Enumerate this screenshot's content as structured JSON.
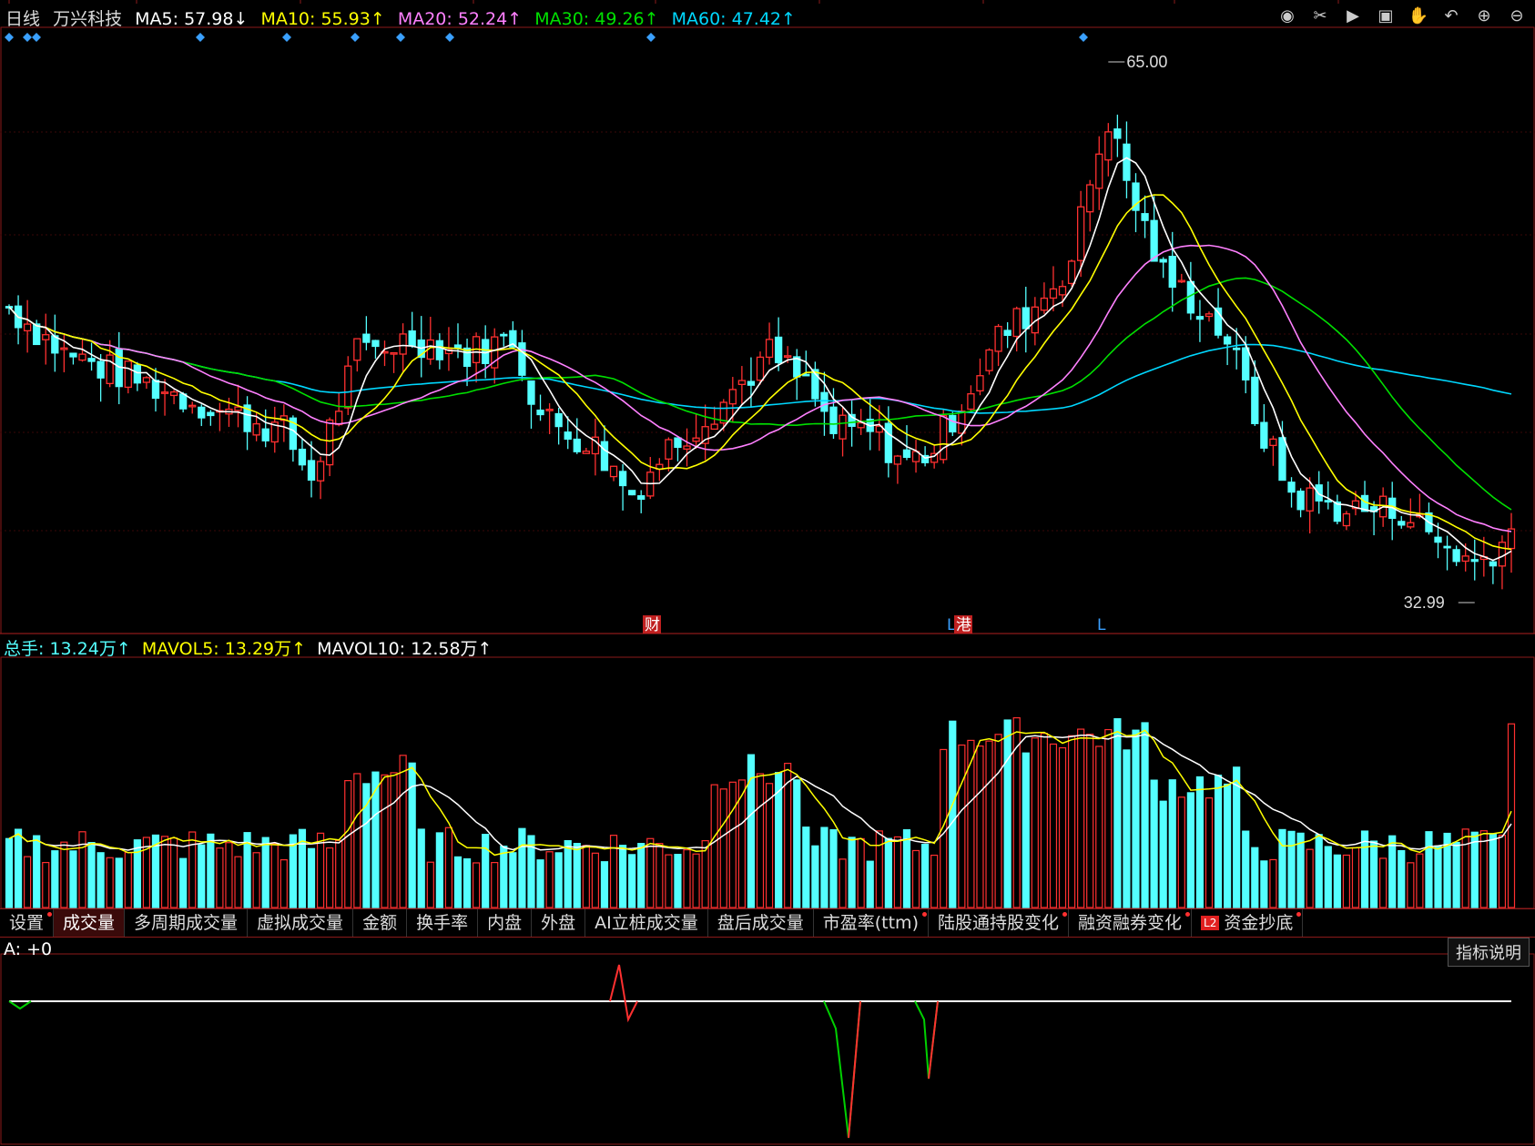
{
  "header": {
    "period": "日线",
    "stock_name": "万兴科技",
    "ma5": {
      "label": "MA5:",
      "value": "57.98↓"
    },
    "ma10": {
      "label": "MA10:",
      "value": "55.93↑"
    },
    "ma20": {
      "label": "MA20:",
      "value": "52.24↑"
    },
    "ma30": {
      "label": "MA30:",
      "value": "49.26↑"
    },
    "ma60": {
      "label": "MA60:",
      "value": "47.42↑"
    }
  },
  "price_chart": {
    "high_label": "65.00",
    "low_label": "32.99",
    "event_marks": [
      "财",
      "L",
      "港",
      "L"
    ]
  },
  "volume_header": {
    "total": {
      "label": "总手:",
      "value": "13.24万↑"
    },
    "mavol5": {
      "label": "MAVOL5:",
      "value": "13.29万↑"
    },
    "mavol10": {
      "label": "MAVOL10:",
      "value": "12.58万↑"
    }
  },
  "tabs": [
    {
      "label": "设置",
      "dot": true
    },
    {
      "label": "成交量",
      "active": true
    },
    {
      "label": "多周期成交量"
    },
    {
      "label": "虚拟成交量"
    },
    {
      "label": "金额"
    },
    {
      "label": "换手率"
    },
    {
      "label": "内盘"
    },
    {
      "label": "外盘"
    },
    {
      "label": "AI立桩成交量"
    },
    {
      "label": "盘后成交量"
    },
    {
      "label": "市盈率(ttm)",
      "dot": true
    },
    {
      "label": "陆股通持股变化",
      "dot": true
    },
    {
      "label": "融资融券变化",
      "dot": true
    },
    {
      "label": "资金抄底",
      "badge": "L2",
      "dot": true
    }
  ],
  "indicator": {
    "a_label": "A: +0",
    "explain_button": "指标说明"
  },
  "toolbar_icons": [
    "eye-icon",
    "scissors-icon",
    "play-icon",
    "lock-icon",
    "hand-icon",
    "undo-icon",
    "zoom-in-icon",
    "zoom-out-icon"
  ],
  "colors": {
    "ma5": "#ffffff",
    "ma10": "#ffff00",
    "ma20": "#ff80ff",
    "ma30": "#00e000",
    "ma60": "#00d8ff",
    "up": "#ff3030",
    "down": "#54ffff"
  }
}
